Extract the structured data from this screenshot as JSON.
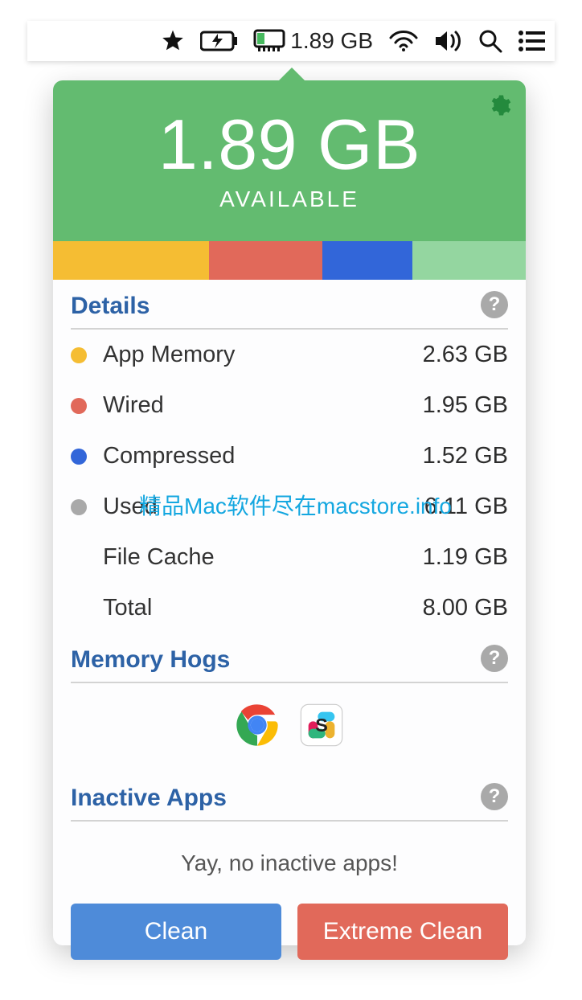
{
  "menubar": {
    "mem_text": "1.89 GB"
  },
  "header": {
    "value": "1.89 GB",
    "label": "AVAILABLE",
    "color": "#63bb70"
  },
  "usage_segments": [
    {
      "color": "#f5bd33",
      "percent": 33
    },
    {
      "color": "#e1695a",
      "percent": 24
    },
    {
      "color": "#3266d9",
      "percent": 19
    },
    {
      "color": "#94d6a0",
      "percent": 24
    }
  ],
  "sections": {
    "details": "Details",
    "hogs": "Memory Hogs",
    "inactive": "Inactive Apps"
  },
  "details": [
    {
      "dot": "#f5bd33",
      "label": "App Memory",
      "value": "2.63 GB"
    },
    {
      "dot": "#e1695a",
      "label": "Wired",
      "value": "1.95 GB"
    },
    {
      "dot": "#3266d9",
      "label": "Compressed",
      "value": "1.52 GB"
    },
    {
      "dot": "#a9a9a9",
      "label": "Used",
      "value": "6.11 GB"
    },
    {
      "dot": "",
      "label": "File Cache",
      "value": "1.19 GB"
    },
    {
      "dot": "",
      "label": "Total",
      "value": "8.00 GB"
    }
  ],
  "hogs": [
    {
      "name": "chrome"
    },
    {
      "name": "slack"
    }
  ],
  "inactive_message": "Yay, no inactive apps!",
  "buttons": {
    "clean": "Clean",
    "extreme": "Extreme Clean"
  },
  "watermark": "精品Mac软件尽在macstore.info",
  "help_glyph": "?"
}
